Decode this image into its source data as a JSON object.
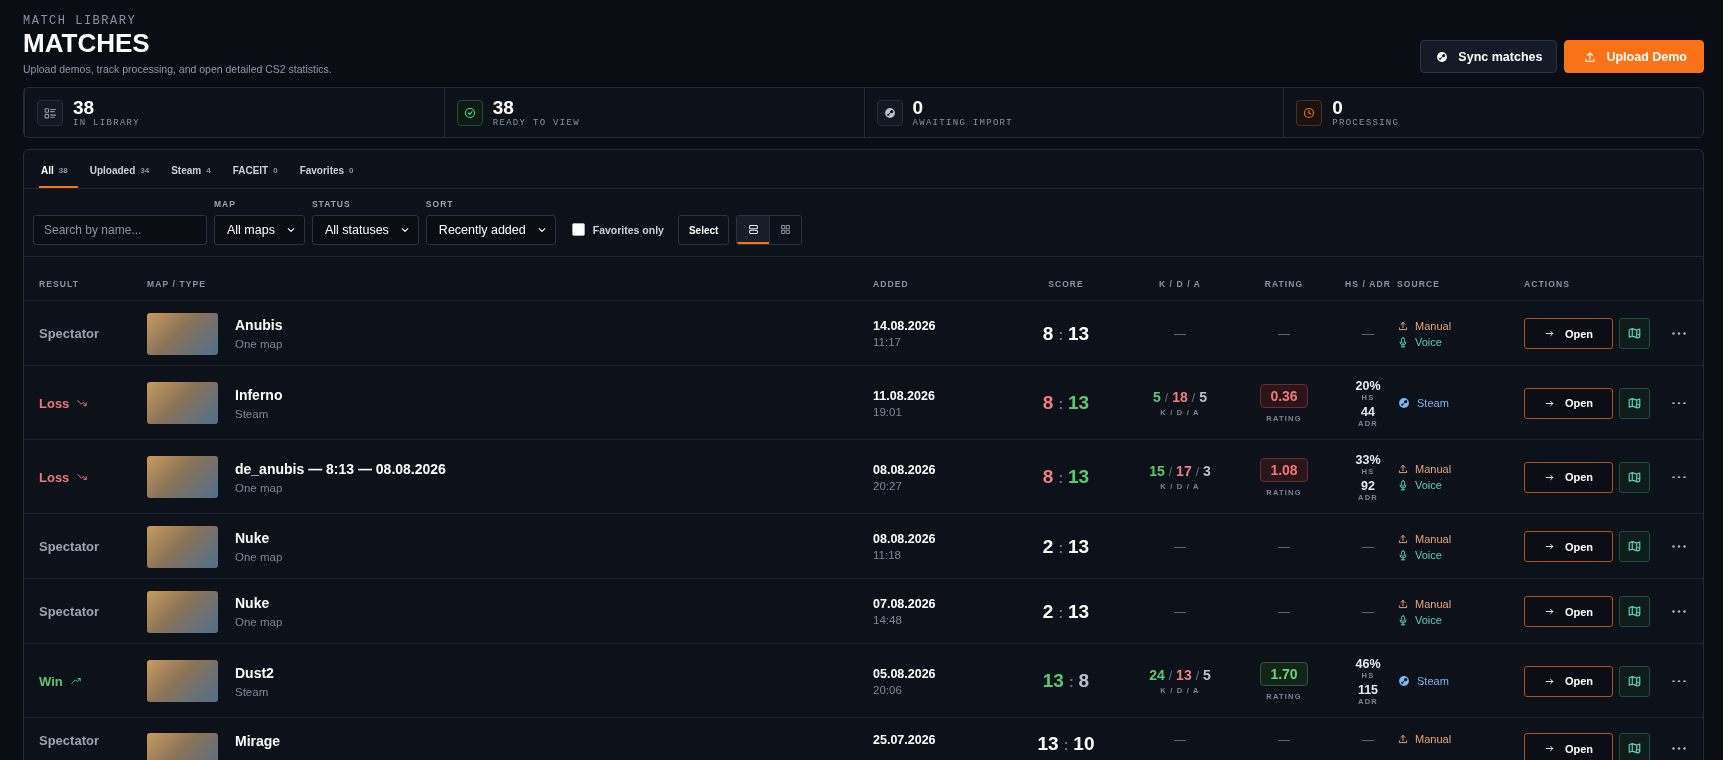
{
  "header": {
    "eyebrow": "MATCH LIBRARY",
    "title": "MATCHES",
    "subtitle": "Upload demos, track processing, and open detailed CS2 statistics."
  },
  "buttons": [
    {
      "label": "Sync matches",
      "kind": "sync"
    },
    {
      "label": "Upload Demo",
      "kind": "upload"
    }
  ],
  "stats": [
    {
      "value": "38",
      "label": "IN LIBRARY",
      "kind": "library"
    },
    {
      "value": "38",
      "label": "READY TO VIEW",
      "kind": "ready"
    },
    {
      "value": "0",
      "label": "AWAITING IMPORT",
      "kind": "steam"
    },
    {
      "value": "0",
      "label": "PROCESSING",
      "kind": "processing"
    }
  ],
  "tabs": [
    {
      "label": "All",
      "count": "38",
      "selected": true
    },
    {
      "label": "Uploaded",
      "count": "34",
      "selected": false
    },
    {
      "label": "Steam",
      "count": "4",
      "selected": false
    },
    {
      "label": "FACEIT",
      "count": "0",
      "selected": false
    },
    {
      "label": "Favorites",
      "count": "0",
      "selected": false
    }
  ],
  "filters": {
    "search": {
      "placeholder": "Search by name..."
    },
    "selects": [
      {
        "label": "MAP",
        "value": "All maps"
      },
      {
        "label": "STATUS",
        "value": "All statuses"
      },
      {
        "label": "SORT",
        "value": "Recently added"
      }
    ],
    "favorites_only": {
      "label": "Favorites only",
      "checked": false
    },
    "select_button": "Select",
    "view_modes": [
      {
        "kind": "list",
        "selected": true
      },
      {
        "kind": "grid",
        "selected": false
      }
    ]
  },
  "table": {
    "columns": [
      "RESULT",
      "MAP / TYPE",
      "ADDED",
      "SCORE",
      "K / D / A",
      "RATING",
      "HS / ADR",
      "SOURCE",
      "ACTIONS"
    ],
    "rows": [
      {
        "result": {
          "text": "Spectator",
          "kind": "spectator"
        },
        "map": "Anubis",
        "type": "One map",
        "date": "14.08.2026",
        "time": "11:17",
        "score": [
          "8",
          ":",
          "13"
        ],
        "kda": {
          "text": "—"
        },
        "rating": {
          "text": "—"
        },
        "hs_adr": {
          "text": "—"
        },
        "sources": [
          {
            "kind": "manual",
            "label": "Manual"
          },
          {
            "kind": "voice",
            "label": "Voice"
          }
        ],
        "open": "Open"
      },
      {
        "result": {
          "text": "Loss",
          "kind": "loss"
        },
        "map": "Inferno",
        "type": "Steam",
        "date": "11.08.2026",
        "time": "19:01",
        "score": [
          "8",
          ":",
          "13"
        ],
        "kda": {
          "k": "5",
          "d": "18",
          "a": "5",
          "sep": "/",
          "label": "K / D / A"
        },
        "rating": {
          "value": "0.36",
          "label": "RATING"
        },
        "hs_adr": {
          "hs": "20%",
          "hs_label": "HS",
          "adr": "44",
          "adr_label": "ADR"
        },
        "sources": [
          {
            "kind": "steam",
            "label": "Steam"
          }
        ],
        "open": "Open"
      },
      {
        "result": {
          "text": "Loss",
          "kind": "loss"
        },
        "map": "de_anubis — 8:13 — 08.08.2026",
        "type": "One map",
        "date": "08.08.2026",
        "time": "20:27",
        "score": [
          "8",
          ":",
          "13"
        ],
        "kda": {
          "k": "15",
          "d": "17",
          "a": "3",
          "sep": "/",
          "label": "K / D / A"
        },
        "rating": {
          "value": "1.08",
          "label": "RATING"
        },
        "hs_adr": {
          "hs": "33%",
          "hs_label": "HS",
          "adr": "92",
          "adr_label": "ADR"
        },
        "sources": [
          {
            "kind": "manual",
            "label": "Manual"
          },
          {
            "kind": "voice",
            "label": "Voice"
          }
        ],
        "open": "Open"
      },
      {
        "result": {
          "text": "Spectator",
          "kind": "spectator"
        },
        "map": "Nuke",
        "type": "One map",
        "date": "08.08.2026",
        "time": "11:18",
        "score": [
          "2",
          ":",
          "13"
        ],
        "kda": {
          "text": "—"
        },
        "rating": {
          "text": "—"
        },
        "hs_adr": {
          "text": "—"
        },
        "sources": [
          {
            "kind": "manual",
            "label": "Manual"
          },
          {
            "kind": "voice",
            "label": "Voice"
          }
        ],
        "open": "Open"
      },
      {
        "result": {
          "text": "Spectator",
          "kind": "spectator"
        },
        "map": "Nuke",
        "type": "One map",
        "date": "07.08.2026",
        "time": "14:48",
        "score": [
          "2",
          ":",
          "13"
        ],
        "kda": {
          "text": "—"
        },
        "rating": {
          "text": "—"
        },
        "hs_adr": {
          "text": "—"
        },
        "sources": [
          {
            "kind": "manual",
            "label": "Manual"
          },
          {
            "kind": "voice",
            "label": "Voice"
          }
        ],
        "open": "Open"
      },
      {
        "result": {
          "text": "Win",
          "kind": "win"
        },
        "map": "Dust2",
        "type": "Steam",
        "date": "05.08.2026",
        "time": "20:06",
        "score": [
          "13",
          ":",
          "8"
        ],
        "kda": {
          "k": "24",
          "d": "13",
          "a": "5",
          "sep": "/",
          "label": "K / D / A"
        },
        "rating": {
          "value": "1.70",
          "label": "RATING"
        },
        "hs_adr": {
          "hs": "46%",
          "hs_label": "HS",
          "adr": "115",
          "adr_label": "ADR"
        },
        "sources": [
          {
            "kind": "steam",
            "label": "Steam"
          }
        ],
        "open": "Open"
      },
      {
        "result": {
          "text": "Spectator",
          "kind": "spectator"
        },
        "map": "Mirage",
        "date": "25.07.2026",
        "score": [
          "13",
          ":",
          "10"
        ],
        "kda": {
          "text": "—"
        },
        "rating": {
          "text": "—"
        },
        "hs_adr": {
          "text": "—"
        },
        "sources": [
          {
            "kind": "manual",
            "label": "Manual"
          }
        ],
        "open": "Open"
      }
    ]
  }
}
